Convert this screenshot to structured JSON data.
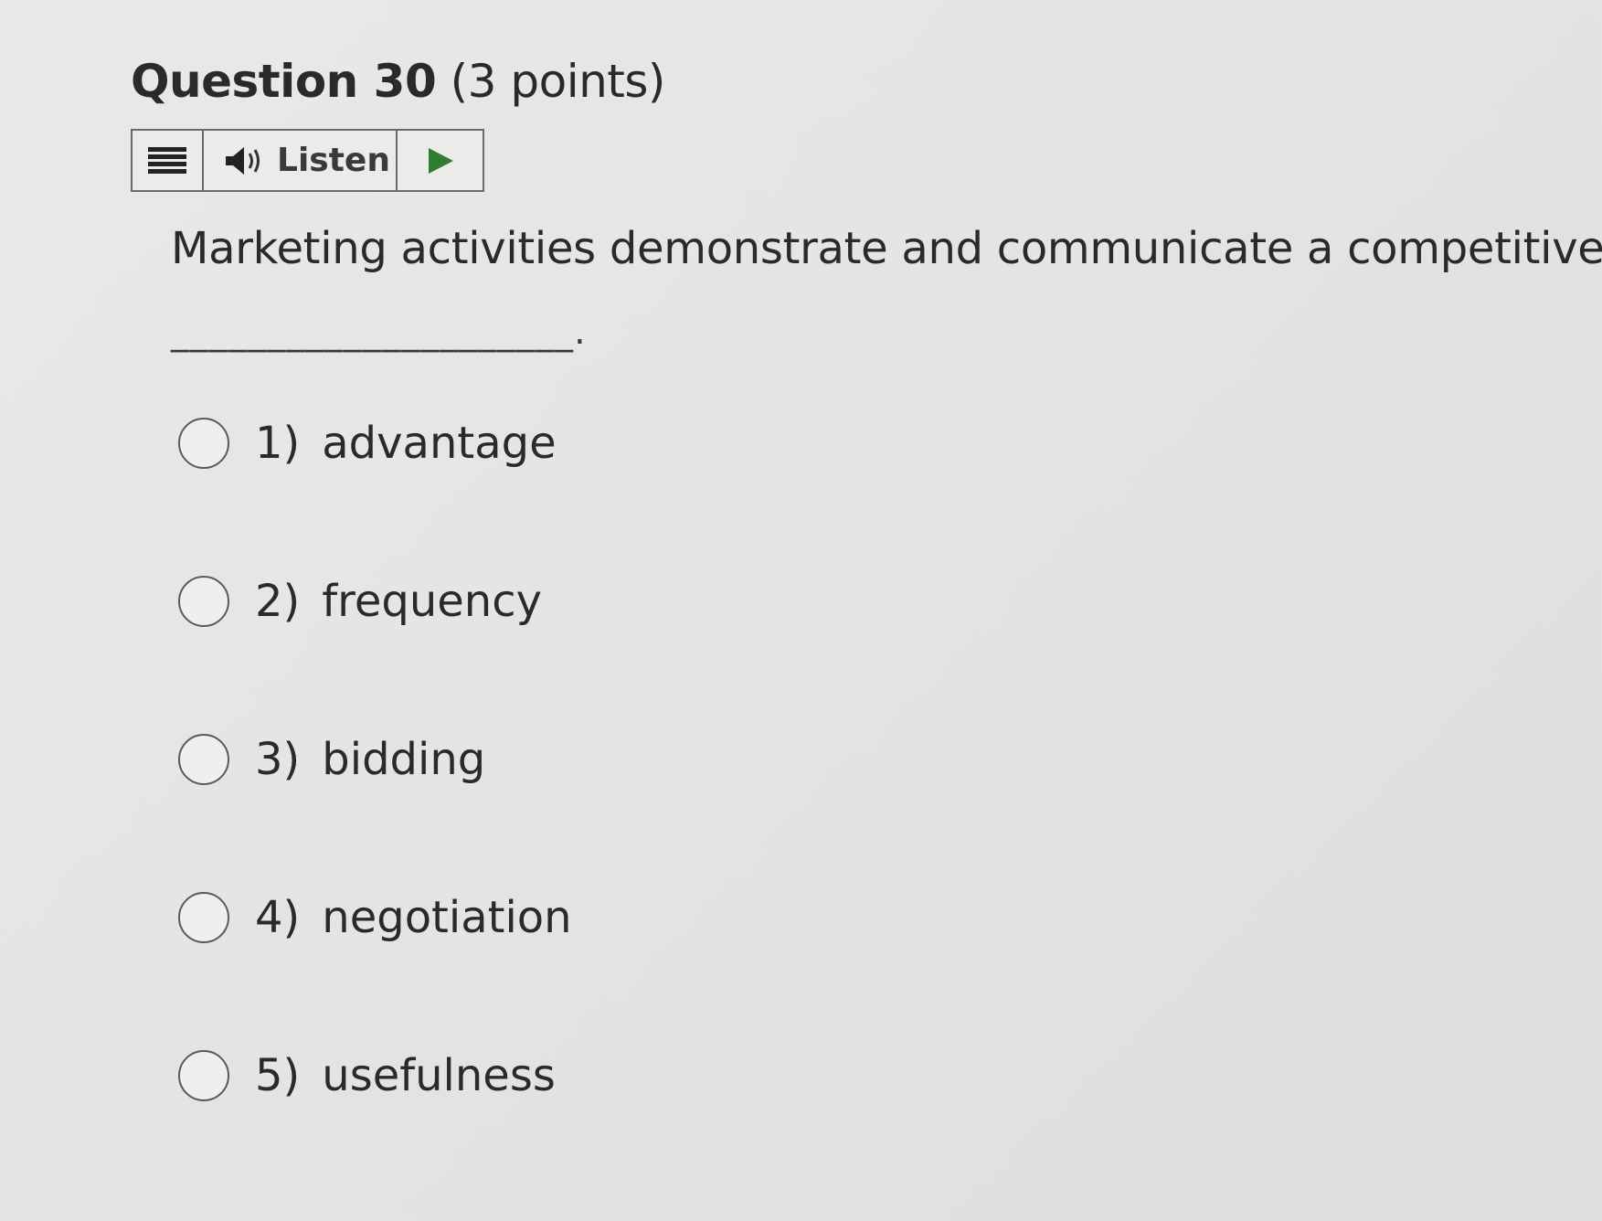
{
  "question": {
    "number_label": "Question 30",
    "points_label": "(3 points)"
  },
  "toolbar": {
    "menu_icon": "menu-icon",
    "speaker_icon": "speaker-icon",
    "listen_label": "Listen",
    "play_icon": "play-icon",
    "play_color": "#2e7d32"
  },
  "prompt": {
    "text": "Marketing activities demonstrate and communicate a competitive",
    "blank": "_____________________."
  },
  "options": [
    {
      "number": "1)",
      "label": "advantage",
      "selected": false
    },
    {
      "number": "2)",
      "label": "frequency",
      "selected": false
    },
    {
      "number": "3)",
      "label": "bidding",
      "selected": false
    },
    {
      "number": "4)",
      "label": "negotiation",
      "selected": false
    },
    {
      "number": "5)",
      "label": "usefulness",
      "selected": false
    }
  ]
}
